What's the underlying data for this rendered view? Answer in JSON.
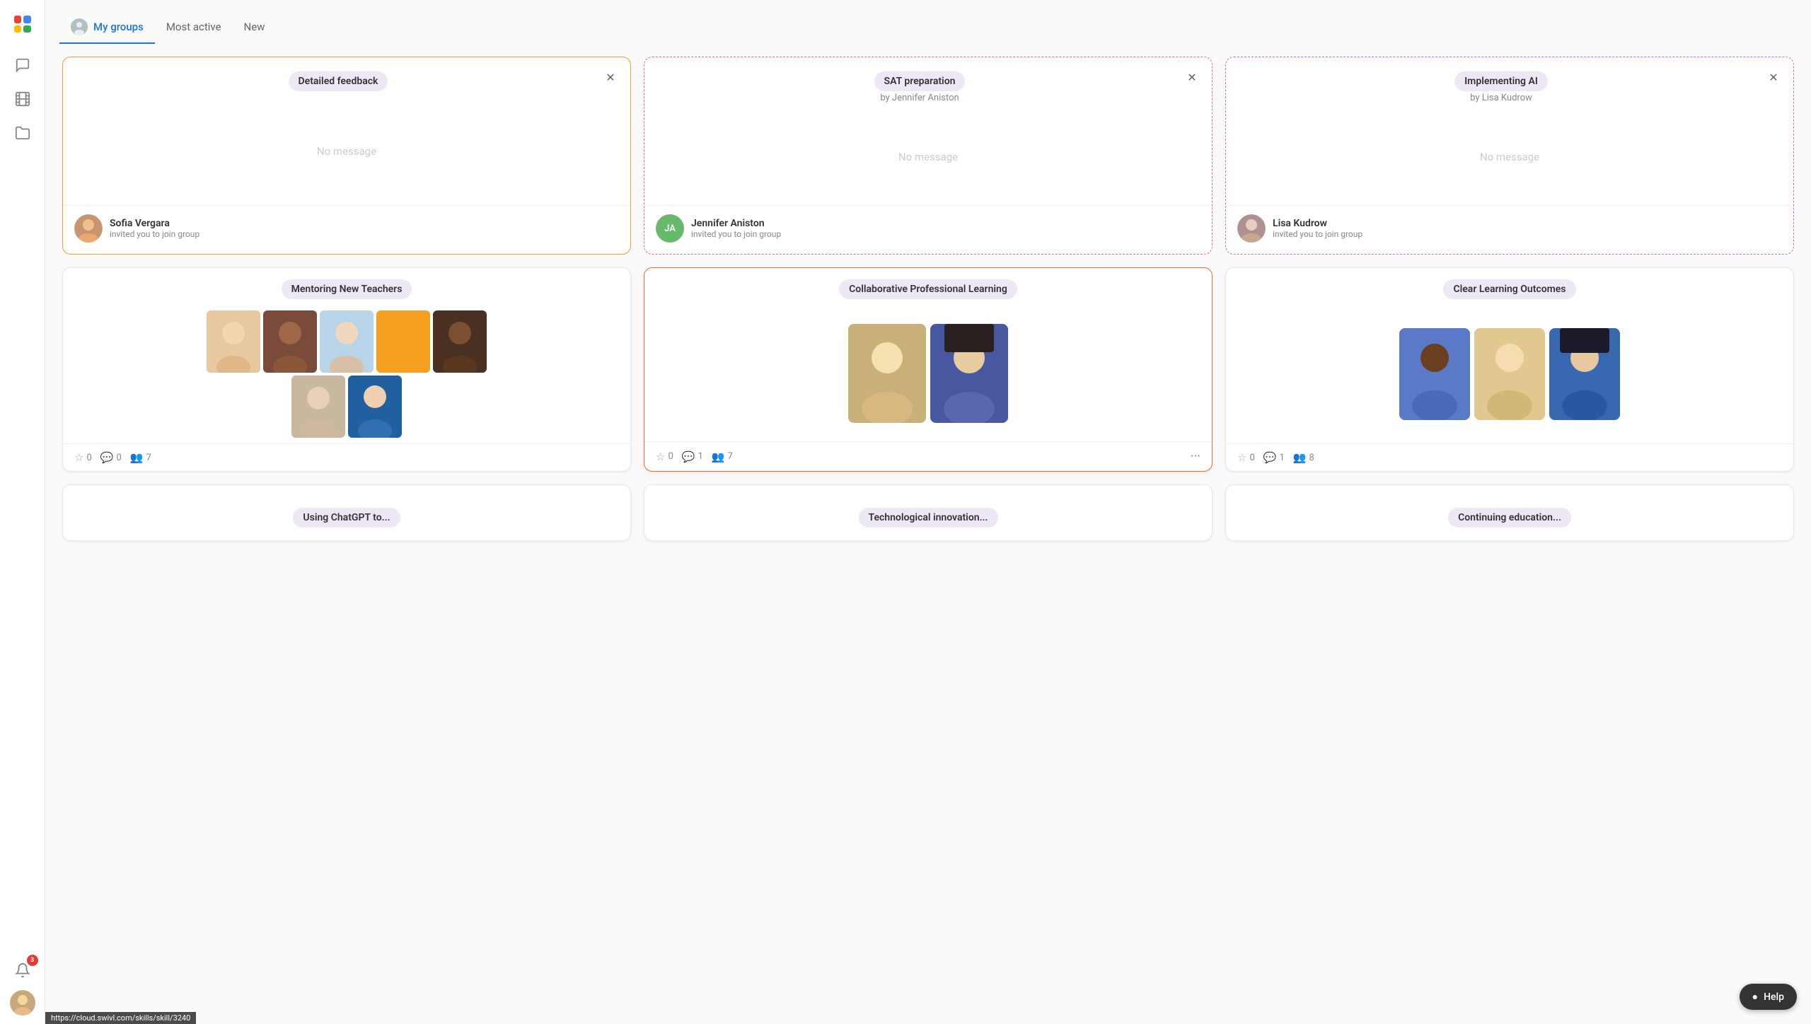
{
  "sidebar": {
    "icons": [
      {
        "name": "chat-icon",
        "symbol": "💬"
      },
      {
        "name": "film-icon",
        "symbol": "🎬"
      },
      {
        "name": "folder-icon",
        "symbol": "📁"
      }
    ],
    "notification_count": "3"
  },
  "tabs": [
    {
      "label": "My groups",
      "active": true,
      "has_avatar": true
    },
    {
      "label": "Most active",
      "active": false,
      "has_avatar": false
    },
    {
      "label": "New",
      "active": false,
      "has_avatar": false
    }
  ],
  "invite_cards": [
    {
      "title": "Detailed feedback",
      "no_message": "No message",
      "inviter_name": "Sofia Vergara",
      "inviter_action": "invited you to join group",
      "border_style": "orange"
    },
    {
      "title": "SAT preparation",
      "subtitle": "by Jennifer Aniston",
      "no_message": "No message",
      "inviter_name": "Jennifer Aniston",
      "inviter_action": "invited you to join group",
      "inviter_initials": "JA",
      "border_style": "pink"
    },
    {
      "title": "Implementing AI",
      "subtitle": "by Lisa Kudrow",
      "no_message": "No message",
      "inviter_name": "Lisa Kudrow",
      "inviter_action": "invited you to join group",
      "border_style": "purple"
    }
  ],
  "group_cards": [
    {
      "title": "Mentoring New Teachers",
      "stars": "0",
      "comments": "0",
      "members": "7"
    },
    {
      "title": "Collaborative Professional Learning",
      "stars": "0",
      "comments": "1",
      "members": "7",
      "has_more": true
    },
    {
      "title": "Clear Learning Outcomes",
      "stars": "0",
      "comments": "1",
      "members": "8"
    }
  ],
  "bottom_cards": [
    {
      "title": "Using ChatGPT to..."
    },
    {
      "title": "Technological innovation..."
    },
    {
      "title": "Continuing education..."
    }
  ],
  "status_url": "https://cloud.swivl.com/skills/skill/3240",
  "help_label": "Help"
}
